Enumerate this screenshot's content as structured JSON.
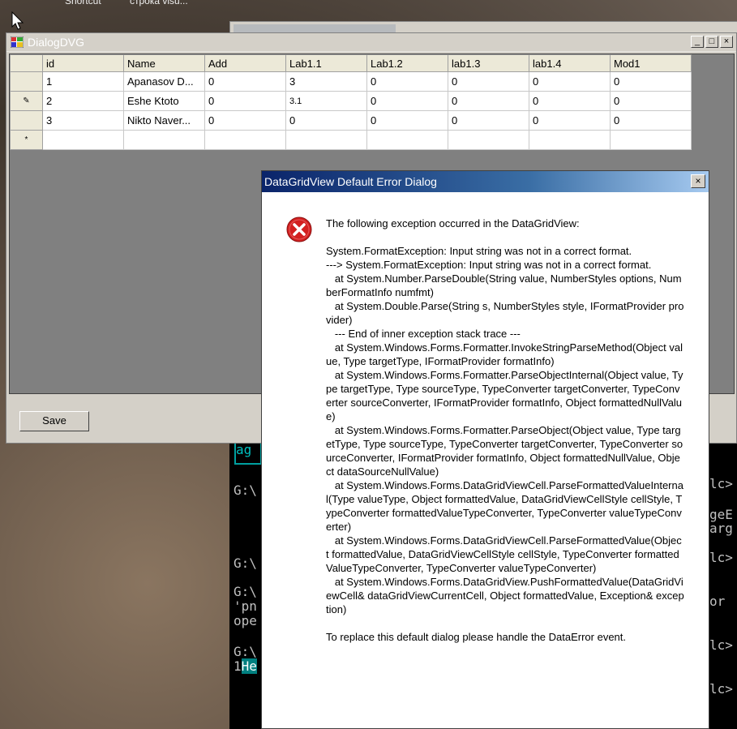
{
  "desktop": {
    "labels": [
      "Shortcut",
      "строка visu..."
    ]
  },
  "console": {
    "lines": [
      "ag",
      "G:\\",
      "G:\\",
      "G:\\",
      "'pn",
      "ope",
      "G:\\",
      "1He",
      "lc>",
      "geE",
      "arg",
      "lc>",
      "or",
      "lc>",
      "lc>"
    ]
  },
  "window": {
    "title": "DialogDVG",
    "minimize": "_",
    "maximize": "□",
    "close": "×"
  },
  "grid": {
    "columns": [
      "id",
      "Name",
      "Add",
      "Lab1.1",
      "Lab1.2",
      "lab1.3",
      "lab1.4",
      "Mod1"
    ],
    "rows": [
      {
        "marker": "",
        "cells": [
          "1",
          "Apanasov D...",
          "0",
          "3",
          "0",
          "0",
          "0",
          "0"
        ]
      },
      {
        "marker": "✎",
        "cells": [
          "2",
          "Eshe Ktoto",
          "0",
          "3.1",
          "0",
          "0",
          "0",
          "0"
        ]
      },
      {
        "marker": "",
        "cells": [
          "3",
          "Nikto Naver...",
          "0",
          "0",
          "0",
          "0",
          "0",
          "0"
        ]
      },
      {
        "marker": "*",
        "cells": [
          "",
          "",
          "",
          "",
          "",
          "",
          "",
          ""
        ]
      }
    ]
  },
  "save_button": "Save",
  "error_dialog": {
    "title": "DataGridView Default Error Dialog",
    "close": "×",
    "icon": "error-icon",
    "intro": "The following exception occurred in the DataGridView:",
    "details": "System.FormatException: Input string was not in a correct format.\n---> System.FormatException: Input string was not in a correct format.\n   at System.Number.ParseDouble(String value, NumberStyles options, NumberFormatInfo numfmt)\n   at System.Double.Parse(String s, NumberStyles style, IFormatProvider provider)\n   --- End of inner exception stack trace ---\n   at System.Windows.Forms.Formatter.InvokeStringParseMethod(Object value, Type targetType, IFormatProvider formatInfo)\n   at System.Windows.Forms.Formatter.ParseObjectInternal(Object value, Type targetType, Type sourceType, TypeConverter targetConverter, TypeConverter sourceConverter, IFormatProvider formatInfo, Object formattedNullValue)\n   at System.Windows.Forms.Formatter.ParseObject(Object value, Type targetType, Type sourceType, TypeConverter targetConverter, TypeConverter sourceConverter, IFormatProvider formatInfo, Object formattedNullValue, Object dataSourceNullValue)\n   at System.Windows.Forms.DataGridViewCell.ParseFormattedValueInternal(Type valueType, Object formattedValue, DataGridViewCellStyle cellStyle, TypeConverter formattedValueTypeConverter, TypeConverter valueTypeConverter)\n   at System.Windows.Forms.DataGridViewCell.ParseFormattedValue(Object formattedValue, DataGridViewCellStyle cellStyle, TypeConverter formattedValueTypeConverter, TypeConverter valueTypeConverter)\n   at System.Windows.Forms.DataGridView.PushFormattedValue(DataGridViewCell& dataGridViewCurrentCell, Object formattedValue, Exception& exception)",
    "footer": "To replace this default dialog please handle the DataError event."
  },
  "colors": {
    "error_red": "#d32020",
    "title_gradient_start": "#0a246a",
    "console_highlight": "#008080"
  }
}
